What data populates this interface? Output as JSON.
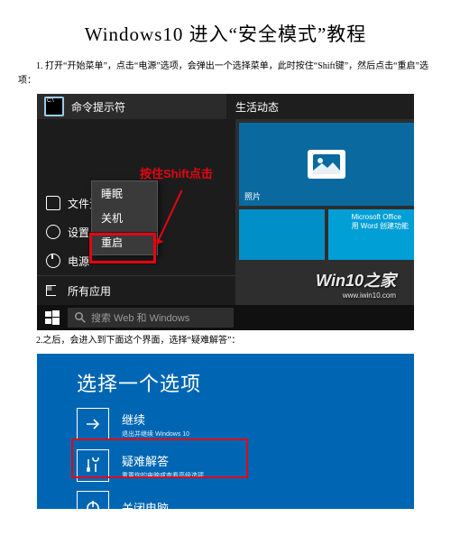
{
  "title": "Windows10 进入“安全模式”教程",
  "steps": {
    "s1": "1. 打开“开始菜单”，点击“电源”选项，会弹出一个选择菜单，此时按住“Shift键”，然后点击“重启”选项：",
    "s2": "2.之后，会进入到下面这个界面，选择“疑难解答”："
  },
  "shot1": {
    "titlebar": "命令提示符",
    "life_activity": "生活动态",
    "power_menu": {
      "sleep": "睡眠",
      "shutdown": "关机",
      "restart": "重启"
    },
    "sidebar": {
      "file_explorer": "文件资源管理器",
      "settings": "设置",
      "power": "电源",
      "all_apps": "所有应用"
    },
    "tiles": {
      "photos": "照片",
      "office_top": "Microsoft Office",
      "office_sub": "用 Word 创建功能"
    },
    "search_placeholder": "搜索 Web 和 Windows",
    "callout": "按住Shift点击",
    "watermark_main": "Win10之家",
    "watermark_sub": "www.iwin10.com"
  },
  "shot2": {
    "heading": "选择一个选项",
    "opts": {
      "continue": {
        "title": "继续",
        "sub": "退出并继续 Windows 10"
      },
      "troubleshoot": {
        "title": "疑难解答",
        "sub": "重置你的电脑或查看高级选项"
      },
      "shutdown": {
        "title": "关闭电脑",
        "sub": ""
      }
    }
  }
}
